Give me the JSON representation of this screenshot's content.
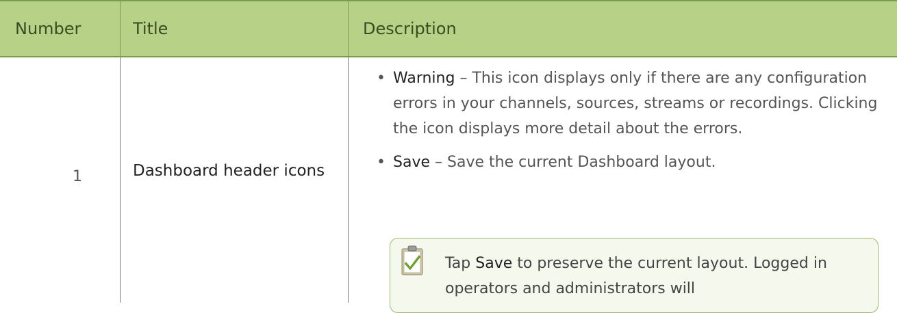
{
  "table": {
    "headers": [
      "Number",
      "Title",
      "Description"
    ],
    "rows": [
      {
        "number": "1",
        "title": "Dashboard header icons",
        "description": [
          {
            "term": "Warning",
            "text": " – This icon displays only if there are any configuration errors in your channels, sources, streams or recordings. Clicking the icon displays more detail about the errors."
          },
          {
            "term": "Save",
            "text": " – Save the current Dashboard layout."
          }
        ],
        "note": {
          "icon": "clipboard-check-icon",
          "prefix": "Tap ",
          "term": "Save",
          "text": " to preserve the current layout. Logged in operators and administrators will"
        }
      }
    ]
  },
  "colors": {
    "header_bg": "#b7d286",
    "header_text": "#3a4a22",
    "note_border": "#9cb86d",
    "note_bg": "#f5f8ec"
  }
}
